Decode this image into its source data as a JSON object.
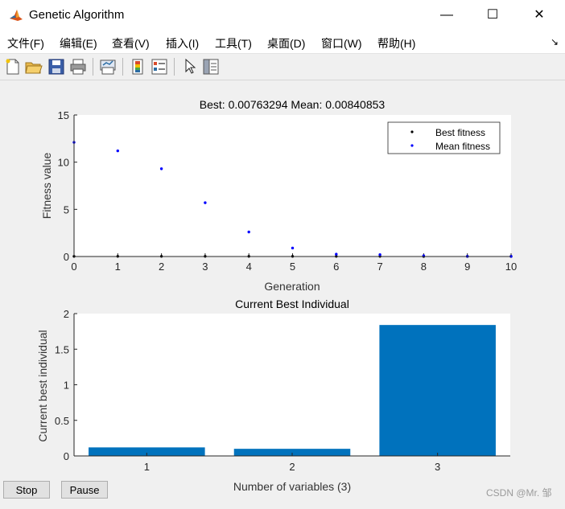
{
  "window": {
    "title": "Genetic Algorithm",
    "minimize_glyph": "—",
    "maximize_glyph": "☐",
    "close_glyph": "✕"
  },
  "menu": {
    "items": [
      "文件(F)",
      "编辑(E)",
      "查看(V)",
      "插入(I)",
      "工具(T)",
      "桌面(D)",
      "窗口(W)",
      "帮助(H)"
    ],
    "overflow_glyph": "↘"
  },
  "toolbar": {
    "icons": [
      "new-figure-icon",
      "open-file-icon",
      "save-icon",
      "print-icon",
      "link-plot-icon",
      "colorbar-icon",
      "legend-icon",
      "pointer-icon",
      "property-inspector-icon"
    ]
  },
  "chart_data": [
    {
      "type": "scatter",
      "title": "Best: 0.00763294 Mean: 0.00840853",
      "xlabel": "Generation",
      "ylabel": "Fitness value",
      "xlim": [
        0,
        10
      ],
      "ylim": [
        0,
        15
      ],
      "xticks": [
        0,
        1,
        2,
        3,
        4,
        5,
        6,
        7,
        8,
        9,
        10
      ],
      "yticks": [
        0,
        5,
        10,
        15
      ],
      "legend_position": "top-right",
      "series": [
        {
          "name": "Best fitness",
          "color": "#000000",
          "x": [
            0,
            1,
            2,
            3,
            4,
            5,
            6,
            7,
            8,
            9,
            10
          ],
          "y": [
            0.02,
            0.02,
            0.02,
            0.02,
            0.02,
            0.02,
            0.02,
            0.02,
            0.01,
            0.01,
            0.01
          ]
        },
        {
          "name": "Mean fitness",
          "color": "#0000ff",
          "x": [
            0,
            1,
            2,
            3,
            4,
            5,
            6,
            7,
            8,
            9,
            10
          ],
          "y": [
            12.1,
            11.2,
            9.3,
            5.7,
            2.6,
            0.9,
            0.25,
            0.2,
            0.08,
            0.02,
            0.01
          ]
        }
      ]
    },
    {
      "type": "bar",
      "title": "Current Best Individual",
      "xlabel": "Number of variables (3)",
      "ylabel": "Current best individual",
      "categories": [
        "1",
        "2",
        "3"
      ],
      "values": [
        0.12,
        0.1,
        1.84
      ],
      "xlim": [
        0.5,
        3.5
      ],
      "ylim": [
        0,
        2
      ],
      "yticks": [
        "0",
        "0.5",
        "1",
        "1.5",
        "2"
      ],
      "bar_color": "#0072bd"
    }
  ],
  "buttons": {
    "stop": "Stop",
    "pause": "Pause"
  },
  "watermark": "CSDN @Mr. 邹"
}
